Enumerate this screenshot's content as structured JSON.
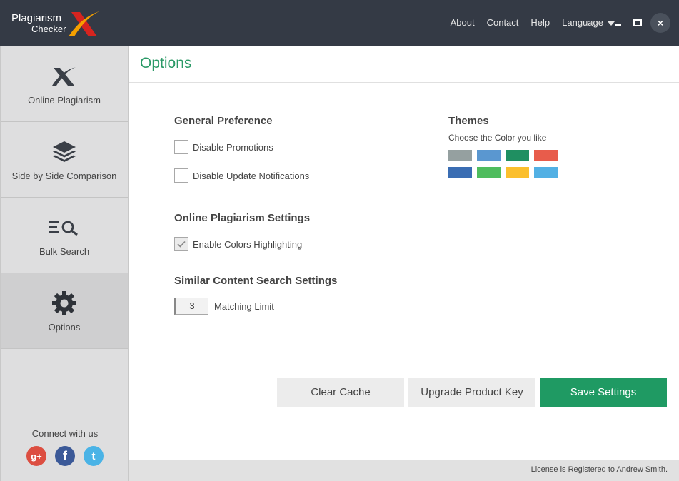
{
  "app": {
    "logo_line1": "Plagiarism",
    "logo_line2": "Checker",
    "brand_colors": {
      "titlebar": "#343a45",
      "accent_green": "#1f9a63",
      "logo_orange": "#f5a000",
      "logo_red": "#d6241f"
    }
  },
  "topnav": {
    "about": "About",
    "contact": "Contact",
    "help": "Help",
    "language": "Language"
  },
  "window_controls": {
    "close": "×"
  },
  "sidebar": {
    "items": [
      {
        "label": "Online Plagiarism",
        "icon": "x-logo-icon"
      },
      {
        "label": "Side by Side Comparison",
        "icon": "layers-icon"
      },
      {
        "label": "Bulk Search",
        "icon": "list-search-icon"
      },
      {
        "label": "Options",
        "icon": "gear-icon",
        "active": true
      }
    ],
    "connect_label": "Connect with us",
    "socials": [
      {
        "name": "google-plus-icon",
        "glyph": "g+",
        "color": "#dc4e41"
      },
      {
        "name": "facebook-icon",
        "glyph": "f",
        "color": "#3b5998"
      },
      {
        "name": "twitter-icon",
        "glyph": "t",
        "color": "#4ab3e6"
      }
    ]
  },
  "main": {
    "title": "Options",
    "general": {
      "heading": "General Preference",
      "disable_promotions": {
        "label": "Disable Promotions",
        "checked": false
      },
      "disable_updates": {
        "label": "Disable Update Notifications",
        "checked": false
      }
    },
    "online": {
      "heading": "Online Plagiarism Settings",
      "enable_colors": {
        "label": "Enable Colors Highlighting",
        "checked": true
      }
    },
    "similar": {
      "heading": "Similar Content Search Settings",
      "matching_limit_value": "3",
      "matching_limit_label": "Matching Limit"
    },
    "themes": {
      "heading": "Themes",
      "subtitle": "Choose the Color you like",
      "colors": [
        "#95a0a0",
        "#5a97d0",
        "#1f8f61",
        "#e85c4b",
        "#3a6db3",
        "#4fbd5e",
        "#fbbf2d",
        "#52b0e4"
      ]
    },
    "buttons": {
      "clear_cache": "Clear Cache",
      "upgrade": "Upgrade Product Key",
      "save": "Save Settings"
    }
  },
  "footer": {
    "license": "License is Registered to Andrew Smith."
  }
}
